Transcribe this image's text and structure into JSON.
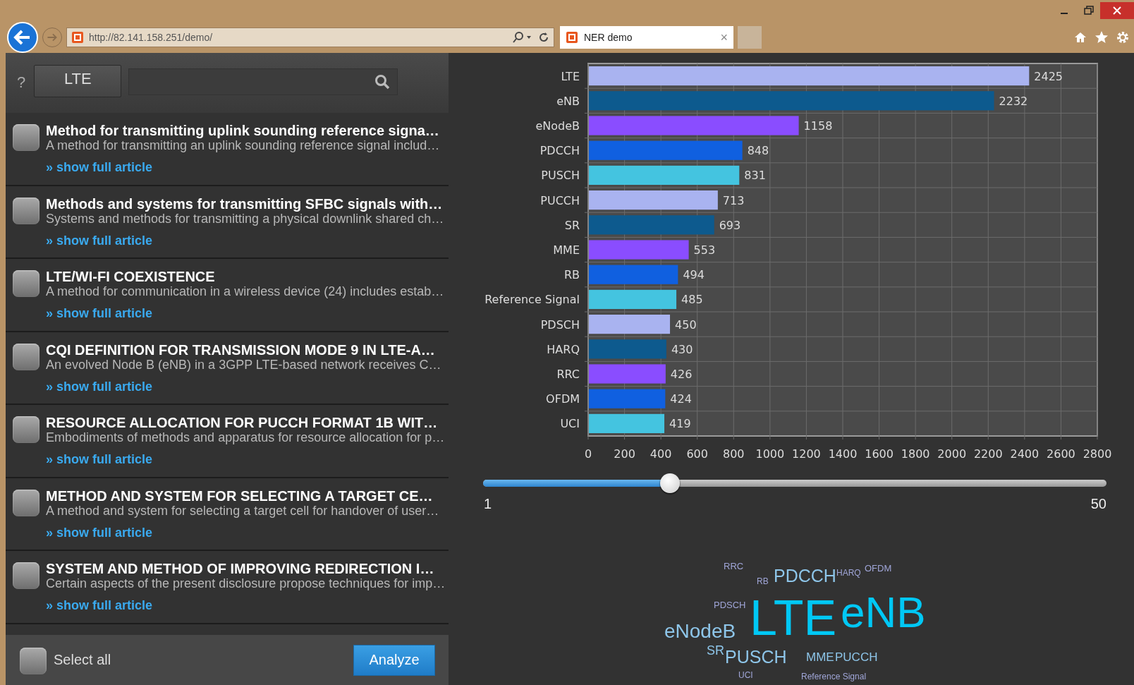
{
  "browser": {
    "address": "http://82.141.158.251/demo/",
    "tab": "NER demo",
    "tab_close": "×"
  },
  "toolbar": {
    "help": "?",
    "tag": "LTE"
  },
  "articles": [
    {
      "title": "Method for transmitting uplink sounding reference signa…",
      "summary": "A method for transmitting an uplink sounding reference signal includ…",
      "link": "» show full article",
      "checked": false
    },
    {
      "title": "Methods and systems for transmitting SFBC signals with…",
      "summary": "Systems and methods for transmitting a physical downlink shared ch…",
      "link": "» show full article",
      "checked": false
    },
    {
      "title": "LTE/WI-FI COEXISTENCE",
      "summary": "A method for communication in a wireless device (24) includes estab…",
      "link": "» show full article",
      "checked": false
    },
    {
      "title": "CQI DEFINITION FOR TRANSMISSION MODE 9 IN LTE-A…",
      "summary": "An evolved Node B (eNB) in a 3GPP LTE-based network receives C…",
      "link": "» show full article",
      "checked": false
    },
    {
      "title": "RESOURCE ALLOCATION FOR PUCCH FORMAT 1B WIT…",
      "summary": "Embodiments of methods and apparatus for resource allocation for p…",
      "link": "» show full article",
      "checked": false
    },
    {
      "title": "METHOD AND SYSTEM FOR SELECTING A TARGET CE…",
      "summary": "A method and system for selecting a target cell for handover of user…",
      "link": "» show full article",
      "checked": false
    },
    {
      "title": "SYSTEM AND METHOD OF IMPROVING REDIRECTION I…",
      "summary": "Certain aspects of the present disclosure propose techniques for imp…",
      "link": "» show full article",
      "checked": false
    }
  ],
  "select_all": {
    "label": "Select all",
    "checked": false
  },
  "analyze_button": "Analyze",
  "chart": {
    "chart_data": {
      "type": "bar",
      "orientation": "horizontal",
      "data_labels": true,
      "categories": [
        "LTE",
        "eNB",
        "eNodeB",
        "PDCCH",
        "PUSCH",
        "PUCCH",
        "SR",
        "MME",
        "RB",
        "Reference Signal",
        "PDSCH",
        "HARQ",
        "RRC",
        "OFDM",
        "UCI"
      ],
      "values": [
        2425,
        2232,
        1158,
        848,
        831,
        713,
        693,
        553,
        494,
        485,
        450,
        430,
        426,
        424,
        419
      ],
      "grid": true,
      "xlim": [
        0,
        2800
      ],
      "xticks": [
        0,
        200,
        400,
        600,
        800,
        1000,
        1200,
        1400,
        1600,
        1800,
        2000,
        2200,
        2400,
        2600,
        2800
      ]
    }
  },
  "slider": {
    "level": 0.3,
    "min_label": "1",
    "max_label": "50"
  },
  "word_cloud": {
    "words": [
      "RRC",
      "RB",
      "PDCCH",
      "HARQ",
      "OFDM",
      "PDSCH",
      "LTE",
      "eNB",
      "eNodeB",
      "SR",
      "PUSCH",
      "MME",
      "PUCCH",
      "UCI",
      "Reference Signal"
    ]
  }
}
